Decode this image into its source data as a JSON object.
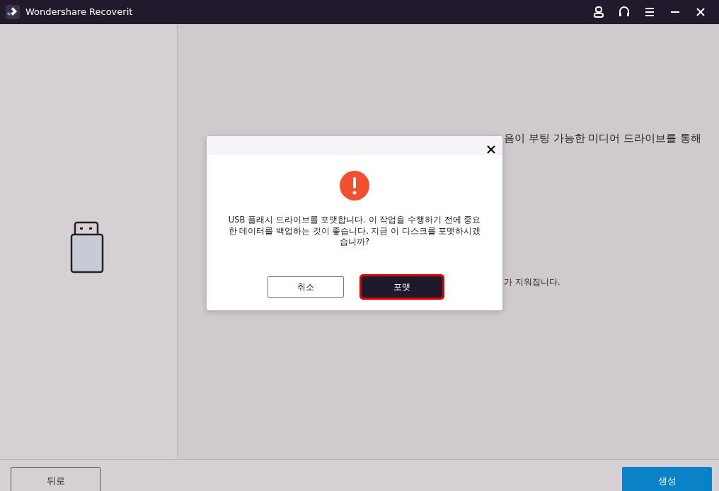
{
  "window": {
    "title": "Wondershare Recoverit"
  },
  "main": {
    "lines": [
      "음이 부팅 가능한 미디어 드라이브를 통해",
      "가 지워집니다."
    ]
  },
  "dialog": {
    "message": "USB 플래시 드라이브를 포맷합니다. 이 작업을 수행하기 전에 중요한 데이터를 백업하는 것이 좋습니다. 지금 이 디스크를 포맷하시겠습니까?",
    "buttons": [
      {
        "label": "취소",
        "kind": "secondary",
        "focused": false
      },
      {
        "label": "포맷",
        "kind": "primary",
        "focused": true
      }
    ]
  },
  "footer": {
    "buttons": [
      {
        "label": "뒤로",
        "kind": "secondary"
      },
      {
        "label": "생성",
        "kind": "primary"
      }
    ]
  }
}
